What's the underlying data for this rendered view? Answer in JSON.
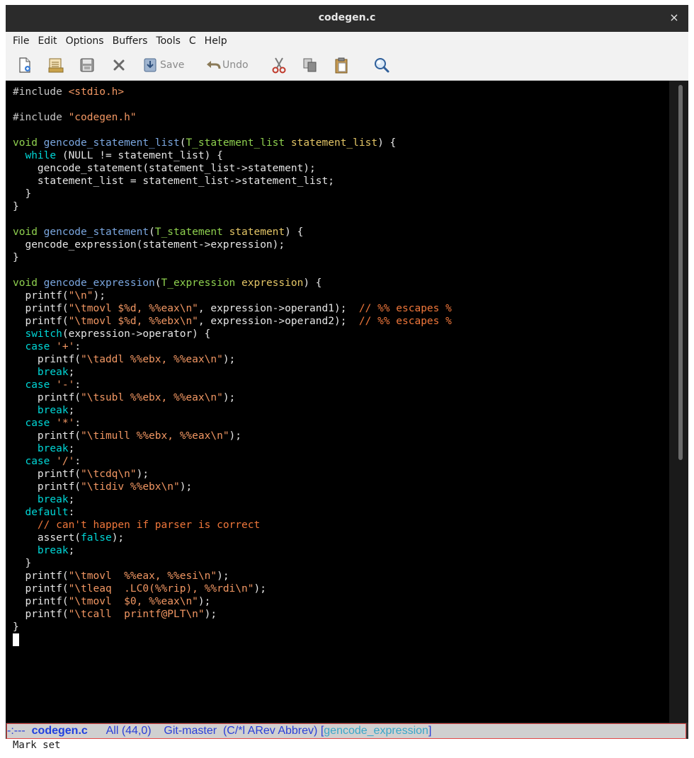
{
  "window": {
    "title": "codegen.c",
    "close_glyph": "×"
  },
  "menu": [
    "File",
    "Edit",
    "Options",
    "Buffers",
    "Tools",
    "C",
    "Help"
  ],
  "toolbar": {
    "items": [
      {
        "name": "new-file-icon"
      },
      {
        "name": "open-folder-icon"
      },
      {
        "name": "disk-icon"
      },
      {
        "name": "close-icon"
      },
      {
        "name": "save-icon",
        "label": "Save"
      },
      {
        "name": "undo-icon",
        "label": "Undo"
      },
      {
        "name": "cut-icon"
      },
      {
        "name": "copy-icon"
      },
      {
        "name": "paste-icon"
      },
      {
        "name": "search-icon"
      }
    ]
  },
  "code": {
    "lines": [
      [
        [
          "pp",
          "#include "
        ],
        [
          "str",
          "<stdio.h>"
        ]
      ],
      [],
      [
        [
          "pp",
          "#include "
        ],
        [
          "str",
          "\"codegen.h\""
        ]
      ],
      [],
      [
        [
          "ty",
          "void "
        ],
        [
          "fn",
          "gencode_statement_list"
        ],
        [
          "",
          "("
        ],
        [
          "ty",
          "T_statement_list "
        ],
        [
          "var",
          "statement_list"
        ],
        [
          "",
          ") {"
        ]
      ],
      [
        [
          "",
          "  "
        ],
        [
          "kw",
          "while"
        ],
        [
          "",
          " (NULL != statement_list) {"
        ]
      ],
      [
        [
          "",
          "    gencode_statement(statement_list->statement);"
        ]
      ],
      [
        [
          "",
          "    statement_list = statement_list->statement_list;"
        ]
      ],
      [
        [
          "",
          "  }"
        ]
      ],
      [
        [
          "",
          "}"
        ]
      ],
      [],
      [
        [
          "ty",
          "void "
        ],
        [
          "fn",
          "gencode_statement"
        ],
        [
          "",
          "("
        ],
        [
          "ty",
          "T_statement "
        ],
        [
          "var",
          "statement"
        ],
        [
          "",
          ") {"
        ]
      ],
      [
        [
          "",
          "  gencode_expression(statement->expression);"
        ]
      ],
      [
        [
          "",
          "}"
        ]
      ],
      [],
      [
        [
          "ty",
          "void "
        ],
        [
          "fn",
          "gencode_expression"
        ],
        [
          "",
          "("
        ],
        [
          "ty",
          "T_expression "
        ],
        [
          "var",
          "expression"
        ],
        [
          "",
          ") {"
        ]
      ],
      [
        [
          "",
          "  printf("
        ],
        [
          "str",
          "\"\\n\""
        ],
        [
          "",
          ");"
        ]
      ],
      [
        [
          "",
          "  printf("
        ],
        [
          "str",
          "\"\\tmovl $%d, %%eax\\n\""
        ],
        [
          "",
          ", expression->operand1);  "
        ],
        [
          "cmt",
          "// %% escapes %"
        ]
      ],
      [
        [
          "",
          "  printf("
        ],
        [
          "str",
          "\"\\tmovl $%d, %%ebx\\n\""
        ],
        [
          "",
          ", expression->operand2);  "
        ],
        [
          "cmt",
          "// %% escapes %"
        ]
      ],
      [
        [
          "",
          "  "
        ],
        [
          "kw",
          "switch"
        ],
        [
          "",
          "(expression->operator) {"
        ]
      ],
      [
        [
          "",
          "  "
        ],
        [
          "kw",
          "case "
        ],
        [
          "str",
          "'+'"
        ],
        [
          "",
          ":"
        ]
      ],
      [
        [
          "",
          "    printf("
        ],
        [
          "str",
          "\"\\taddl %%ebx, %%eax\\n\""
        ],
        [
          "",
          ");"
        ]
      ],
      [
        [
          "",
          "    "
        ],
        [
          "kw",
          "break"
        ],
        [
          "",
          ";"
        ]
      ],
      [
        [
          "",
          "  "
        ],
        [
          "kw",
          "case "
        ],
        [
          "str",
          "'-'"
        ],
        [
          "",
          ":"
        ]
      ],
      [
        [
          "",
          "    printf("
        ],
        [
          "str",
          "\"\\tsubl %%ebx, %%eax\\n\""
        ],
        [
          "",
          ");"
        ]
      ],
      [
        [
          "",
          "    "
        ],
        [
          "kw",
          "break"
        ],
        [
          "",
          ";"
        ]
      ],
      [
        [
          "",
          "  "
        ],
        [
          "kw",
          "case "
        ],
        [
          "str",
          "'*'"
        ],
        [
          "",
          ":"
        ]
      ],
      [
        [
          "",
          "    printf("
        ],
        [
          "str",
          "\"\\timull %%ebx, %%eax\\n\""
        ],
        [
          "",
          ");"
        ]
      ],
      [
        [
          "",
          "    "
        ],
        [
          "kw",
          "break"
        ],
        [
          "",
          ";"
        ]
      ],
      [
        [
          "",
          "  "
        ],
        [
          "kw",
          "case "
        ],
        [
          "str",
          "'/'"
        ],
        [
          "",
          ":"
        ]
      ],
      [
        [
          "",
          "    printf("
        ],
        [
          "str",
          "\"\\tcdq\\n\""
        ],
        [
          "",
          ");"
        ]
      ],
      [
        [
          "",
          "    printf("
        ],
        [
          "str",
          "\"\\tidiv %%ebx\\n\""
        ],
        [
          "",
          ");"
        ]
      ],
      [
        [
          "",
          "    "
        ],
        [
          "kw",
          "break"
        ],
        [
          "",
          ";"
        ]
      ],
      [
        [
          "",
          "  "
        ],
        [
          "kw",
          "default"
        ],
        [
          "",
          ":"
        ]
      ],
      [
        [
          "",
          "    "
        ],
        [
          "cmt",
          "// can't happen if parser is correct"
        ]
      ],
      [
        [
          "",
          "    assert("
        ],
        [
          "kw",
          "false"
        ],
        [
          "",
          ");"
        ]
      ],
      [
        [
          "",
          "    "
        ],
        [
          "kw",
          "break"
        ],
        [
          "",
          ";"
        ]
      ],
      [
        [
          "",
          "  }"
        ]
      ],
      [
        [
          "",
          "  printf("
        ],
        [
          "str",
          "\"\\tmovl  %%eax, %%esi\\n\""
        ],
        [
          "",
          ");"
        ]
      ],
      [
        [
          "",
          "  printf("
        ],
        [
          "str",
          "\"\\tleaq  .LC0(%%rip), %%rdi\\n\""
        ],
        [
          "",
          ");"
        ]
      ],
      [
        [
          "",
          "  printf("
        ],
        [
          "str",
          "\"\\tmovl  $0, %%eax\\n\""
        ],
        [
          "",
          ");"
        ]
      ],
      [
        [
          "",
          "  printf("
        ],
        [
          "str",
          "\"\\tcall  printf@PLT\\n\""
        ],
        [
          "",
          ");"
        ]
      ],
      [
        [
          "",
          "}"
        ]
      ]
    ]
  },
  "modeline": {
    "status": "-:---",
    "buffer": "codegen.c",
    "position": "All (44,0)",
    "vc": "Git-master",
    "modes": "(C/*l ARev Abbrev)",
    "which_func": "gencode_expression",
    "open_bracket": "[",
    "close_bracket": "]"
  },
  "minibuffer": {
    "text": "Mark set"
  },
  "colors": {
    "keyword": "#00d7d7",
    "function": "#7ba7e0",
    "type": "#8fd14f",
    "string": "#f29763",
    "variable": "#e3c566",
    "comment": "#f0773b"
  }
}
